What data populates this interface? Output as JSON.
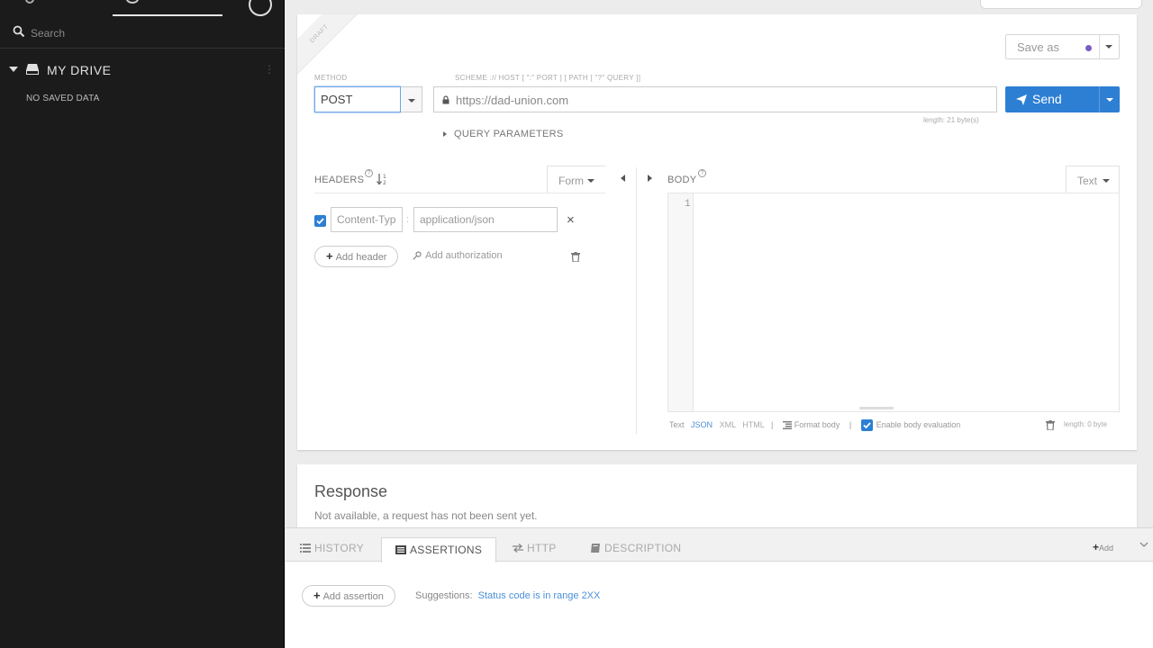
{
  "sidebar": {
    "search_placeholder": "Search",
    "drive_label": "MY DRIVE",
    "drive_menu": "⋮",
    "empty_text": "NO SAVED DATA"
  },
  "request": {
    "draft_label": "DRAFT",
    "method_label": "METHOD",
    "method_value": "POST",
    "url_hint": "SCHEME :// HOST [ \":\" PORT ] [ PATH [ \"?\" QUERY ]]",
    "url_value": "https://dad-union.com",
    "url_length": "length: 21 byte(s)",
    "send_label": "Send",
    "save_as_label": "Save as",
    "query_params_label": "QUERY PARAMETERS"
  },
  "headers": {
    "label": "HEADERS",
    "help": "?",
    "mode_label": "Form",
    "rows": [
      {
        "name": "Content-Type",
        "value": "application/json",
        "remove": "×"
      }
    ],
    "add_header_label": "Add header",
    "add_auth_label": "Add authorization"
  },
  "body": {
    "label": "BODY",
    "help": "?",
    "mode_label": "Text",
    "line_number": "1",
    "footer_text": "Text",
    "footer_json": "JSON",
    "footer_xml": "XML",
    "footer_html": "HTML",
    "footer_sep": "|",
    "format_label": "Format body",
    "eval_label": "Enable body evaluation",
    "length": "length: 0 byte"
  },
  "response": {
    "title": "Response",
    "status": "Not available, a request has not been sent yet."
  },
  "bottom": {
    "tabs": [
      {
        "label": "HISTORY",
        "icon": "list-icon"
      },
      {
        "label": "ASSERTIONS",
        "icon": "assertions-icon"
      },
      {
        "label": "HTTP",
        "icon": "swap-icon"
      },
      {
        "label": "DESCRIPTION",
        "icon": "book-icon"
      }
    ],
    "add_label": "Add",
    "add_assertion_label": "Add assertion",
    "suggestions_label": "Suggestions:",
    "suggestion_link": "Status code is in range 2XX"
  },
  "colors": {
    "accent": "#2d7fd4",
    "sidebar_bg": "#1b1b1b",
    "saveas_dot": "#7b5cc4"
  }
}
